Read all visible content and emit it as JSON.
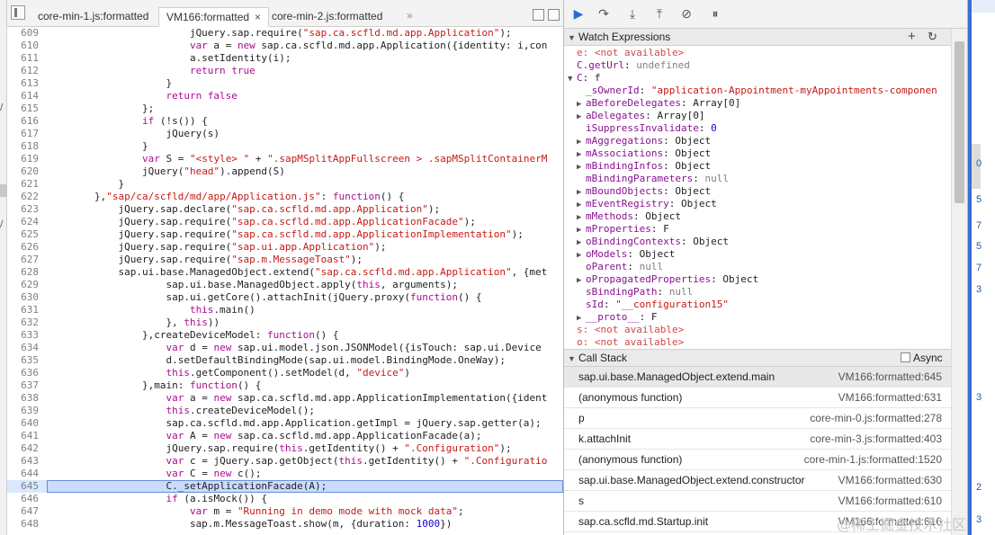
{
  "tabs": [
    {
      "label": "core-min-1.js:formatted"
    },
    {
      "label": "VM166:formatted",
      "close": "×"
    },
    {
      "label": "core-min-2.js:formatted"
    }
  ],
  "tab_overflow": "»",
  "left_strip_marks": [
    "/",
    "/"
  ],
  "code_lines": [
    {
      "n": "609",
      "t": [
        [
          "p",
          "                        jQuery.sap.require("
        ],
        [
          "s",
          "\"sap.ca.scfld.md.app.Application\""
        ],
        [
          "p",
          ");"
        ]
      ]
    },
    {
      "n": "610",
      "t": [
        [
          "k",
          "                        var"
        ],
        [
          "p",
          " a = "
        ],
        [
          "k",
          "new"
        ],
        [
          "p",
          " sap.ca.scfld.md.app.Application({identity: i,con"
        ]
      ]
    },
    {
      "n": "611",
      "t": [
        [
          "p",
          "                        a.setIdentity(i);"
        ]
      ]
    },
    {
      "n": "612",
      "t": [
        [
          "k",
          "                        return"
        ],
        [
          "p",
          " "
        ],
        [
          "k",
          "true"
        ]
      ]
    },
    {
      "n": "613",
      "t": [
        [
          "p",
          "                    }"
        ]
      ]
    },
    {
      "n": "614",
      "t": [
        [
          "k",
          "                    return"
        ],
        [
          "p",
          " "
        ],
        [
          "k",
          "false"
        ]
      ]
    },
    {
      "n": "615",
      "t": [
        [
          "p",
          "                };"
        ]
      ]
    },
    {
      "n": "616",
      "t": [
        [
          "k",
          "                if"
        ],
        [
          "p",
          " (!s()) {"
        ]
      ]
    },
    {
      "n": "617",
      "t": [
        [
          "p",
          "                    jQuery(s)"
        ]
      ]
    },
    {
      "n": "618",
      "t": [
        [
          "p",
          "                }"
        ]
      ]
    },
    {
      "n": "619",
      "t": [
        [
          "k",
          "                var"
        ],
        [
          "p",
          " S = "
        ],
        [
          "s",
          "\"<style> \""
        ],
        [
          "p",
          " + "
        ],
        [
          "s",
          "\".sapMSplitAppFullscreen > .sapMSplitContainerM"
        ]
      ]
    },
    {
      "n": "620",
      "t": [
        [
          "p",
          "                jQuery("
        ],
        [
          "s",
          "\"head\""
        ],
        [
          "p",
          ").append(S)"
        ]
      ]
    },
    {
      "n": "621",
      "t": [
        [
          "p",
          "            }"
        ]
      ]
    },
    {
      "n": "622",
      "t": [
        [
          "p",
          "        },"
        ],
        [
          "s",
          "\"sap/ca/scfld/md/app/Application.js\""
        ],
        [
          "p",
          ": "
        ],
        [
          "k",
          "function"
        ],
        [
          "p",
          "() {"
        ]
      ]
    },
    {
      "n": "623",
      "t": [
        [
          "p",
          "            jQuery.sap.declare("
        ],
        [
          "s",
          "\"sap.ca.scfld.md.app.Application\""
        ],
        [
          "p",
          ");"
        ]
      ]
    },
    {
      "n": "624",
      "t": [
        [
          "p",
          "            jQuery.sap.require("
        ],
        [
          "s",
          "\"sap.ca.scfld.md.app.ApplicationFacade\""
        ],
        [
          "p",
          ");"
        ]
      ]
    },
    {
      "n": "625",
      "t": [
        [
          "p",
          "            jQuery.sap.require("
        ],
        [
          "s",
          "\"sap.ca.scfld.md.app.ApplicationImplementation\""
        ],
        [
          "p",
          ");"
        ]
      ]
    },
    {
      "n": "626",
      "t": [
        [
          "p",
          "            jQuery.sap.require("
        ],
        [
          "s",
          "\"sap.ui.app.Application\""
        ],
        [
          "p",
          ");"
        ]
      ]
    },
    {
      "n": "627",
      "t": [
        [
          "p",
          "            jQuery.sap.require("
        ],
        [
          "s",
          "\"sap.m.MessageToast\""
        ],
        [
          "p",
          ");"
        ]
      ]
    },
    {
      "n": "628",
      "t": [
        [
          "p",
          "            sap.ui.base.ManagedObject.extend("
        ],
        [
          "s",
          "\"sap.ca.scfld.md.app.Application\""
        ],
        [
          "p",
          ", {met"
        ]
      ]
    },
    {
      "n": "629",
      "t": [
        [
          "p",
          "                    sap.ui.base.ManagedObject.apply("
        ],
        [
          "k",
          "this"
        ],
        [
          "p",
          ", arguments);"
        ]
      ]
    },
    {
      "n": "630",
      "t": [
        [
          "p",
          "                    sap.ui.getCore().attachInit(jQuery.proxy("
        ],
        [
          "k",
          "function"
        ],
        [
          "p",
          "() {"
        ]
      ]
    },
    {
      "n": "631",
      "t": [
        [
          "k",
          "                        this"
        ],
        [
          "p",
          ".main()"
        ]
      ]
    },
    {
      "n": "632",
      "t": [
        [
          "p",
          "                    }, "
        ],
        [
          "k",
          "this"
        ],
        [
          "p",
          "))"
        ]
      ]
    },
    {
      "n": "633",
      "t": [
        [
          "p",
          "                },createDeviceModel: "
        ],
        [
          "k",
          "function"
        ],
        [
          "p",
          "() {"
        ]
      ]
    },
    {
      "n": "634",
      "t": [
        [
          "k",
          "                    var"
        ],
        [
          "p",
          " d = "
        ],
        [
          "k",
          "new"
        ],
        [
          "p",
          " sap.ui.model.json.JSONModel({isTouch: sap.ui.Device"
        ]
      ]
    },
    {
      "n": "635",
      "t": [
        [
          "p",
          "                    d.setDefaultBindingMode(sap.ui.model.BindingMode.OneWay);"
        ]
      ]
    },
    {
      "n": "636",
      "t": [
        [
          "k",
          "                    this"
        ],
        [
          "p",
          ".getComponent().setModel(d, "
        ],
        [
          "s",
          "\"device\""
        ],
        [
          "p",
          ")"
        ]
      ]
    },
    {
      "n": "637",
      "t": [
        [
          "p",
          "                },main: "
        ],
        [
          "k",
          "function"
        ],
        [
          "p",
          "() {"
        ]
      ]
    },
    {
      "n": "638",
      "t": [
        [
          "k",
          "                    var"
        ],
        [
          "p",
          " a = "
        ],
        [
          "k",
          "new"
        ],
        [
          "p",
          " sap.ca.scfld.md.app.ApplicationImplementation({ident"
        ]
      ]
    },
    {
      "n": "639",
      "t": [
        [
          "k",
          "                    this"
        ],
        [
          "p",
          ".createDeviceModel();"
        ]
      ]
    },
    {
      "n": "640",
      "t": [
        [
          "p",
          "                    sap.ca.scfld.md.app.Application.getImpl = jQuery.sap.getter(a);"
        ]
      ]
    },
    {
      "n": "641",
      "t": [
        [
          "k",
          "                    var"
        ],
        [
          "p",
          " A = "
        ],
        [
          "k",
          "new"
        ],
        [
          "p",
          " sap.ca.scfld.md.app.ApplicationFacade(a);"
        ]
      ]
    },
    {
      "n": "642",
      "t": [
        [
          "p",
          "                    jQuery.sap.require("
        ],
        [
          "k",
          "this"
        ],
        [
          "p",
          ".getIdentity() + "
        ],
        [
          "s",
          "\".Configuration\""
        ],
        [
          "p",
          ");"
        ]
      ]
    },
    {
      "n": "643",
      "t": [
        [
          "k",
          "                    var"
        ],
        [
          "p",
          " c = jQuery.sap.getObject("
        ],
        [
          "k",
          "this"
        ],
        [
          "p",
          ".getIdentity() + "
        ],
        [
          "s",
          "\".Configuratio"
        ]
      ]
    },
    {
      "n": "644",
      "t": [
        [
          "k",
          "                    var"
        ],
        [
          "p",
          " C = "
        ],
        [
          "k",
          "new"
        ],
        [
          "p",
          " c();"
        ]
      ]
    },
    {
      "n": "645",
      "hl": true,
      "t": [
        [
          "p",
          "                    C._setApplicationFacade(A);"
        ]
      ]
    },
    {
      "n": "646",
      "t": [
        [
          "k",
          "                    if"
        ],
        [
          "p",
          " (a.isMock()) {"
        ]
      ]
    },
    {
      "n": "647",
      "t": [
        [
          "k",
          "                        var"
        ],
        [
          "p",
          " m = "
        ],
        [
          "s",
          "\"Running in demo mode with mock data\""
        ],
        [
          "p",
          ";"
        ]
      ]
    },
    {
      "n": "648",
      "t": [
        [
          "p",
          "                        sap.m.MessageToast.show(m, {duration: "
        ],
        [
          "n",
          "1000"
        ],
        [
          "p",
          "})"
        ]
      ]
    }
  ],
  "debug_toolbar": {
    "buttons": [
      {
        "name": "resume-button",
        "glyph": "▶"
      },
      {
        "name": "step-over-button",
        "glyph": "↷"
      },
      {
        "name": "step-into-button",
        "glyph": "⤓"
      },
      {
        "name": "step-out-button",
        "glyph": "⤒"
      },
      {
        "name": "deactivate-breakpoints-button",
        "glyph": "⊘"
      },
      {
        "name": "pause-exceptions-button",
        "glyph": "⏸"
      }
    ]
  },
  "watch": {
    "title": "Watch Expressions",
    "add_glyph": "+",
    "refresh_glyph": "↻",
    "rows": [
      {
        "indent": 0,
        "exp": "",
        "key": "e",
        "sep": ": ",
        "val": "<not available>",
        "cls": "wna"
      },
      {
        "indent": 0,
        "exp": "",
        "key": "C.getUrl",
        "sep": ": ",
        "val": "undefined",
        "cls": "wnull"
      },
      {
        "indent": 0,
        "exp": "▼",
        "key": "C",
        "sep": ": ",
        "val": "f",
        "cls": "wv"
      },
      {
        "indent": 1,
        "exp": "",
        "key": "_sOwnerId",
        "sep": ": ",
        "val": "\"application-Appointment-myAppointments-componen",
        "cls": "ws"
      },
      {
        "indent": 1,
        "exp": "▶",
        "key": "aBeforeDelegates",
        "sep": ": ",
        "val": "Array[0]",
        "cls": "wv"
      },
      {
        "indent": 1,
        "exp": "▶",
        "key": "aDelegates",
        "sep": ": ",
        "val": "Array[0]",
        "cls": "wv"
      },
      {
        "indent": 1,
        "exp": "",
        "key": "iSuppressInvalidate",
        "sep": ": ",
        "val": "0",
        "cls": "wnum"
      },
      {
        "indent": 1,
        "exp": "▶",
        "key": "mAggregations",
        "sep": ": ",
        "val": "Object",
        "cls": "wv"
      },
      {
        "indent": 1,
        "exp": "▶",
        "key": "mAssociations",
        "sep": ": ",
        "val": "Object",
        "cls": "wv"
      },
      {
        "indent": 1,
        "exp": "▶",
        "key": "mBindingInfos",
        "sep": ": ",
        "val": "Object",
        "cls": "wv"
      },
      {
        "indent": 1,
        "exp": "",
        "key": "mBindingParameters",
        "sep": ": ",
        "val": "null",
        "cls": "wnull"
      },
      {
        "indent": 1,
        "exp": "▶",
        "key": "mBoundObjects",
        "sep": ": ",
        "val": "Object",
        "cls": "wv"
      },
      {
        "indent": 1,
        "exp": "▶",
        "key": "mEventRegistry",
        "sep": ": ",
        "val": "Object",
        "cls": "wv"
      },
      {
        "indent": 1,
        "exp": "▶",
        "key": "mMethods",
        "sep": ": ",
        "val": "Object",
        "cls": "wv"
      },
      {
        "indent": 1,
        "exp": "▶",
        "key": "mProperties",
        "sep": ": ",
        "val": "F",
        "cls": "wv"
      },
      {
        "indent": 1,
        "exp": "▶",
        "key": "oBindingContexts",
        "sep": ": ",
        "val": "Object",
        "cls": "wv"
      },
      {
        "indent": 1,
        "exp": "▶",
        "key": "oModels",
        "sep": ": ",
        "val": "Object",
        "cls": "wv"
      },
      {
        "indent": 1,
        "exp": "",
        "key": "oParent",
        "sep": ": ",
        "val": "null",
        "cls": "wnull"
      },
      {
        "indent": 1,
        "exp": "▶",
        "key": "oPropagatedProperties",
        "sep": ": ",
        "val": "Object",
        "cls": "wv"
      },
      {
        "indent": 1,
        "exp": "",
        "key": "sBindingPath",
        "sep": ": ",
        "val": "null",
        "cls": "wnull"
      },
      {
        "indent": 1,
        "exp": "",
        "key": "sId",
        "sep": ": ",
        "val": "\"__configuration15\"",
        "cls": "ws"
      },
      {
        "indent": 1,
        "exp": "▶",
        "key": "__proto__",
        "sep": ": ",
        "val": "F",
        "cls": "wv"
      },
      {
        "indent": 0,
        "exp": "",
        "key": "s",
        "sep": ": ",
        "val": "<not available>",
        "cls": "wna"
      },
      {
        "indent": 0,
        "exp": "",
        "key": "o",
        "sep": ": ",
        "val": "<not available>",
        "cls": "wna"
      }
    ]
  },
  "callstack": {
    "title": "Call Stack",
    "async_label": "Async",
    "frames": [
      {
        "fn": "sap.ui.base.ManagedObject.extend.main",
        "loc": "VM166:formatted:645",
        "selected": true
      },
      {
        "fn": "(anonymous function)",
        "loc": "VM166:formatted:631"
      },
      {
        "fn": "p",
        "loc": "core-min-0.js:formatted:278"
      },
      {
        "fn": "k.attachInit",
        "loc": "core-min-3.js:formatted:403"
      },
      {
        "fn": "(anonymous function)",
        "loc": "core-min-1.js:formatted:1520"
      },
      {
        "fn": "sap.ui.base.ManagedObject.extend.constructor",
        "loc": "VM166:formatted:630"
      },
      {
        "fn": "s",
        "loc": "VM166:formatted:610"
      },
      {
        "fn": "sap.ca.scfld.md.Startup.init",
        "loc": "VM166:formatted:616"
      }
    ]
  },
  "right_strip_numbers": [
    "0",
    "5",
    "7",
    "5",
    "7",
    "3",
    "3",
    "2",
    "3"
  ],
  "watermark": "@稀土掘金技术社区",
  "colors": {
    "accent": "#3b6fd1",
    "highlight": "#c9dcff",
    "string": "#c41a16",
    "keyword": "#aa0d91"
  }
}
